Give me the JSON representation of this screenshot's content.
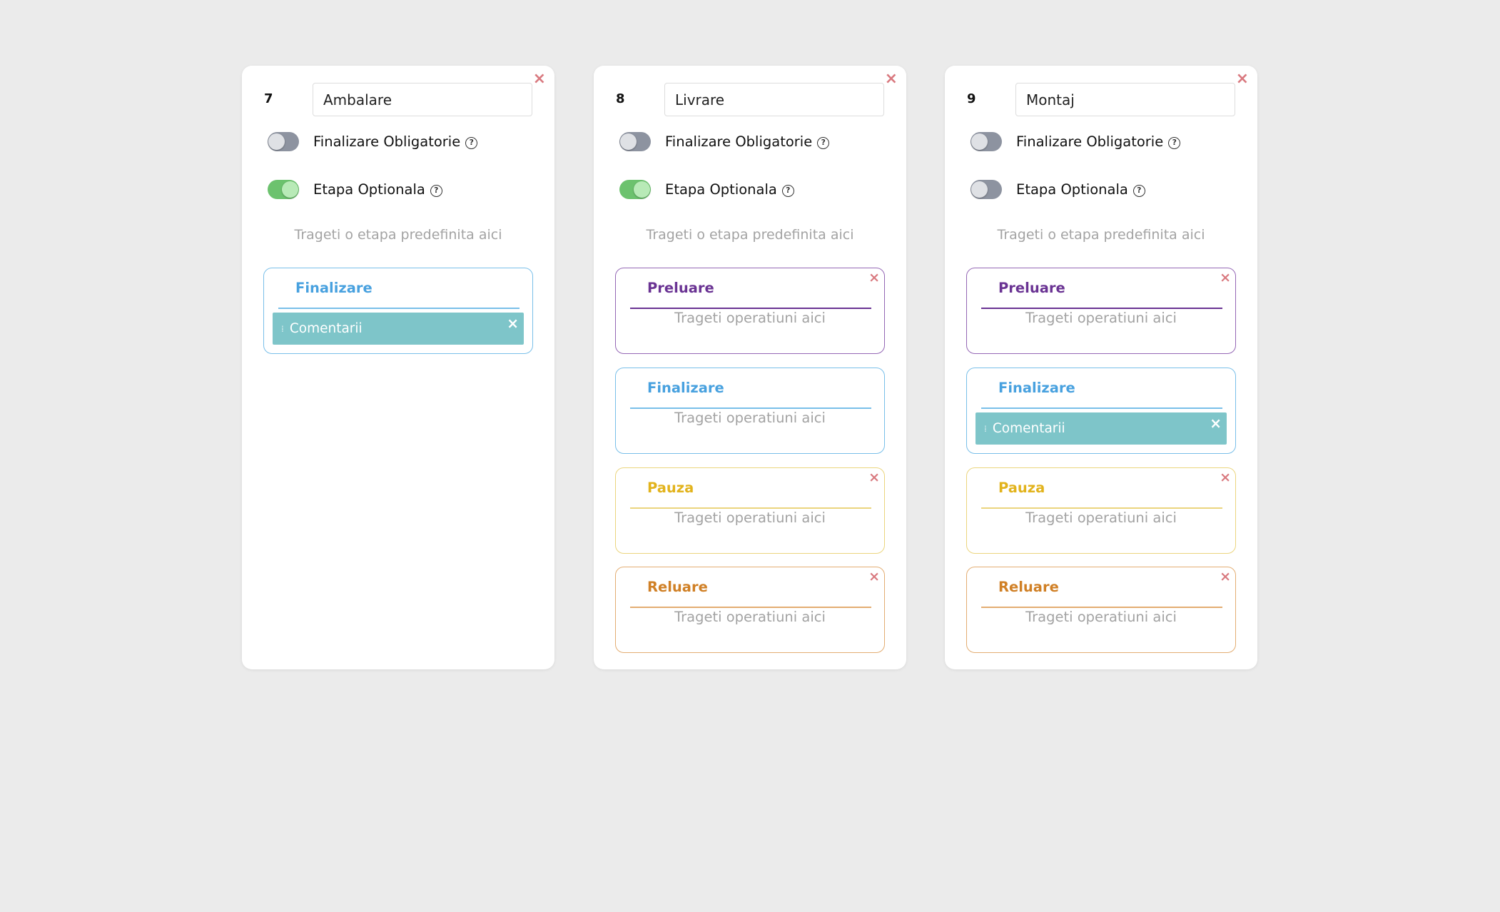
{
  "colors": {
    "preluare": "#6a3393",
    "finalizare": "#48a1df",
    "pauza": "#e2b31c",
    "reluare": "#d08026",
    "close": "#d9797f",
    "item_bg": "#7ec5c9",
    "toggle_on": "#6cc26e",
    "toggle_off": "#8d93a0"
  },
  "icons": {
    "close": "close-icon",
    "help": "help-circle-icon",
    "drag": "drag-handle-icon"
  },
  "labels": {
    "finalizare_obligatorie": "Finalizare Obligatorie",
    "etapa_optionala": "Etapa Optionala",
    "drop_stage_hint": "Trageti o etapa predefinita aici",
    "drop_ops_hint": "Trageti operatiuni aici",
    "help_glyph": "?",
    "close_glyph": "×",
    "drag_glyph": "⁞"
  },
  "cards": [
    {
      "number": "7",
      "name": "Ambalare",
      "finalizare_obligatorie": false,
      "etapa_optionala": true,
      "operations": [
        {
          "title": "Finalizare",
          "kind": "finalizare",
          "closable": false,
          "items": [
            "Comentarii"
          ]
        }
      ]
    },
    {
      "number": "8",
      "name": "Livrare",
      "finalizare_obligatorie": false,
      "etapa_optionala": true,
      "operations": [
        {
          "title": "Preluare",
          "kind": "preluare",
          "closable": true,
          "items": []
        },
        {
          "title": "Finalizare",
          "kind": "finalizare",
          "closable": false,
          "items": []
        },
        {
          "title": "Pauza",
          "kind": "pauza",
          "closable": true,
          "items": []
        },
        {
          "title": "Reluare",
          "kind": "reluare",
          "closable": true,
          "items": []
        }
      ]
    },
    {
      "number": "9",
      "name": "Montaj",
      "finalizare_obligatorie": false,
      "etapa_optionala": false,
      "operations": [
        {
          "title": "Preluare",
          "kind": "preluare",
          "closable": true,
          "items": []
        },
        {
          "title": "Finalizare",
          "kind": "finalizare",
          "closable": false,
          "items": [
            "Comentarii"
          ]
        },
        {
          "title": "Pauza",
          "kind": "pauza",
          "closable": true,
          "items": []
        },
        {
          "title": "Reluare",
          "kind": "reluare",
          "closable": true,
          "items": []
        }
      ]
    }
  ]
}
